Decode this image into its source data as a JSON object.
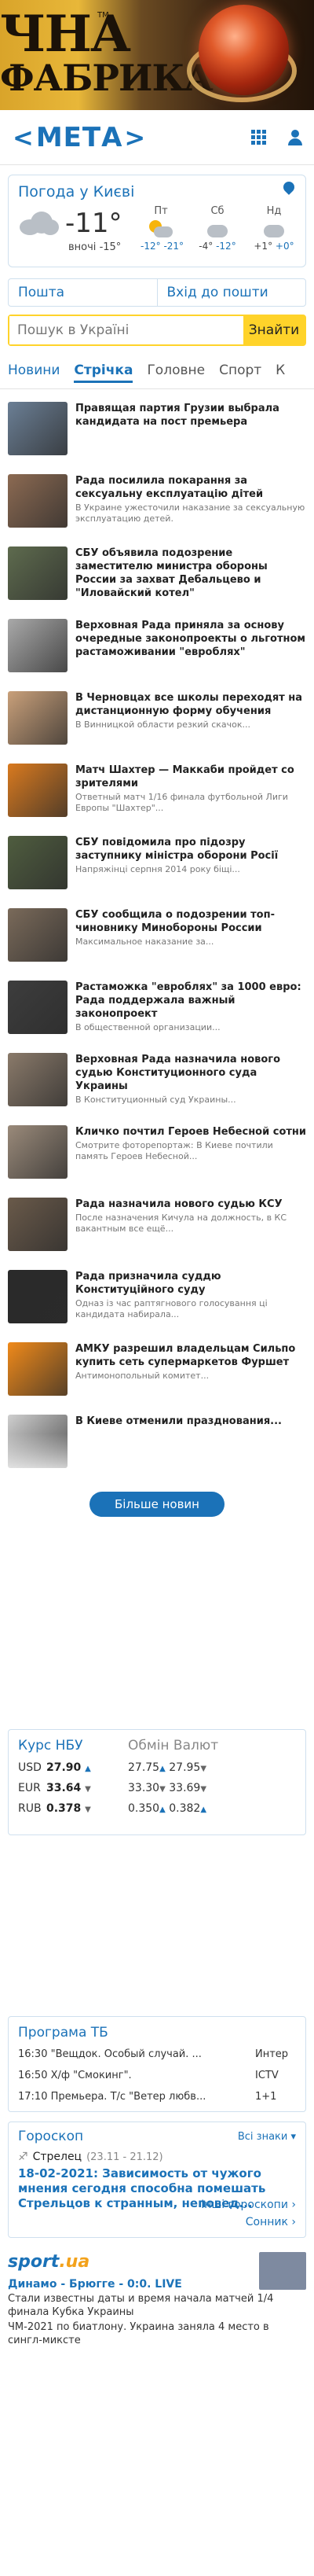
{
  "banner": {
    "line1": "ЧНА",
    "line2": "ФАБРИКА",
    "tm": "ТМ"
  },
  "header": {
    "logo_text": "МЕТА",
    "logo_arrow_left": "<",
    "logo_arrow_right": ">"
  },
  "weather": {
    "title": "Погода у Києві",
    "current_temp": "-11°",
    "night_label": "вночі",
    "night_temp": "-15°",
    "days": [
      {
        "name": "Пт",
        "lo": "-12°",
        "hi": "-21°",
        "icon": "sun-cloud-icon"
      },
      {
        "name": "Сб",
        "lo": "-4°",
        "hi": "-12°",
        "icon": "cloud-icon"
      },
      {
        "name": "Нд",
        "lo": "+1°",
        "hi": "+0°",
        "icon": "cloud-icon"
      }
    ]
  },
  "links": {
    "mail": "Пошта",
    "login": "Вхід до пошти"
  },
  "search": {
    "placeholder": "Пошук в Україні",
    "button": "Знайти"
  },
  "tabs": [
    "Новини",
    "Стрічка",
    "Головне",
    "Спорт",
    "К"
  ],
  "news": [
    {
      "title": "Правящая партия Грузии выбрала кандидата на пост премьера",
      "sub": "",
      "thumb": "#6b7f95"
    },
    {
      "title": "Рада посилила покарання за сексуальну експлуатацію дітей",
      "sub": "В Украине ужесточили наказание за сексуальную эксплуатацию детей.",
      "thumb": "#8c6a52"
    },
    {
      "title": "СБУ объявила подозрение заместителю министра обороны России за захват Дебальцево и \"Иловайский котел\"",
      "sub": "",
      "thumb": "#5e6b4e"
    },
    {
      "title": "Верховная Рада приняла за основу очередные законопроекты о льготном растаможивании \"евроблях\"",
      "sub": "",
      "thumb": "#a9a9a9"
    },
    {
      "title": "В Черновцах все школы переходят на дистанционную форму обучения",
      "sub": "В Винницкой области резкий скачок...",
      "thumb": "#c9a07a"
    },
    {
      "title": "Матч Шахтер — Маккаби пройдет со зрителями",
      "sub": "Ответный матч 1/16 финала футбольной Лиги Европы \"Шахтер\"...",
      "thumb": "#d97a1f"
    },
    {
      "title": "СБУ повідомила про підозру заступнику міністра оборони Росії",
      "sub": "Напряжінці серпня 2014 року біщі...",
      "thumb": "#4f5d3f"
    },
    {
      "title": "СБУ сообщила о подозрении топ-чиновнику Минобороны России",
      "sub": "Максимальное наказание за...",
      "thumb": "#7a6a5a"
    },
    {
      "title": "Растаможка \"евроблях\" за 1000 евро: Рада поддержала важный законопроект",
      "sub": "В общественной организации...",
      "thumb": "#3d3d3d"
    },
    {
      "title": "Верховная Рада назначила нового судью Конституционного суда Украины",
      "sub": "В Конституционный суд Украины...",
      "thumb": "#8a7a6a"
    },
    {
      "title": "Кличко почтил Героев Небесной сотни",
      "sub": "Смотрите фоторепортаж: В Киеве почтили память Героев Небесной...",
      "thumb": "#9a8a7a"
    },
    {
      "title": "Рада назначила нового судью КСУ",
      "sub": "После назначения Кичула на должность, в КС вакантным все ещё...",
      "thumb": "#6a5a4a"
    },
    {
      "title": "Рада призначила суддю Конституційного суду",
      "sub": "Одназ із час раптягнового голосування ці кандидата набирала...",
      "thumb": "#2a2a2a"
    },
    {
      "title": "АМКУ разрешил владельцам Сильпо купить сеть супермаркетов Фуршет",
      "sub": "Антимонопольный комитет...",
      "thumb": "#f08a1a"
    },
    {
      "title": "В Киеве отменили празднования...",
      "sub": "",
      "thumb": "#cfcfcf"
    }
  ],
  "more_button": "Більше новин",
  "currency": {
    "title_nbu": "Курс НБУ",
    "title_exchange": "Обмін Валют",
    "rows": [
      {
        "code": "USD",
        "nbu": "27.90",
        "nbu_dir": "up",
        "buy": "27.75",
        "buy_dir": "up",
        "sell": "27.95",
        "sell_dir": "down"
      },
      {
        "code": "EUR",
        "nbu": "33.64",
        "nbu_dir": "down",
        "buy": "33.30",
        "buy_dir": "down",
        "sell": "33.69",
        "sell_dir": "down"
      },
      {
        "code": "RUB",
        "nbu": "0.378",
        "nbu_dir": "down",
        "buy": "0.350",
        "buy_dir": "up",
        "sell": "0.382",
        "sell_dir": "up"
      }
    ]
  },
  "tv": {
    "title": "Програма ТБ",
    "rows": [
      {
        "show": "16:30 \"Вещдок. Особый случай. ...",
        "channel": "Интер"
      },
      {
        "show": "16:50 Х/ф \"Смокинг\".",
        "channel": "ICTV"
      },
      {
        "show": "17:10 Премьера. Т/с \"Ветер любв...",
        "channel": "1+1"
      }
    ]
  },
  "horoscope": {
    "title": "Гороскоп",
    "all_signs": "Всі знаки ▾",
    "sign": "Стрелец",
    "dates": "(23.11 - 21.12)",
    "text": "18-02-2021: Зависимость от чужого мнения сегодня способна помешать Стрельцов к странным, неповед...",
    "more_link": "Інші гороскопи",
    "dream_link": "Сонник"
  },
  "sport": {
    "logo_main": "sport",
    "logo_suffix": ".ua",
    "headline": "Динамо - Брюгге - 0:0. LIVE",
    "line1": "Стали известны даты и время начала матчей 1/4 финала Кубка Украины",
    "line2": "ЧМ-2021 по биатлону. Украина заняла 4 место в сингл-миксте"
  }
}
